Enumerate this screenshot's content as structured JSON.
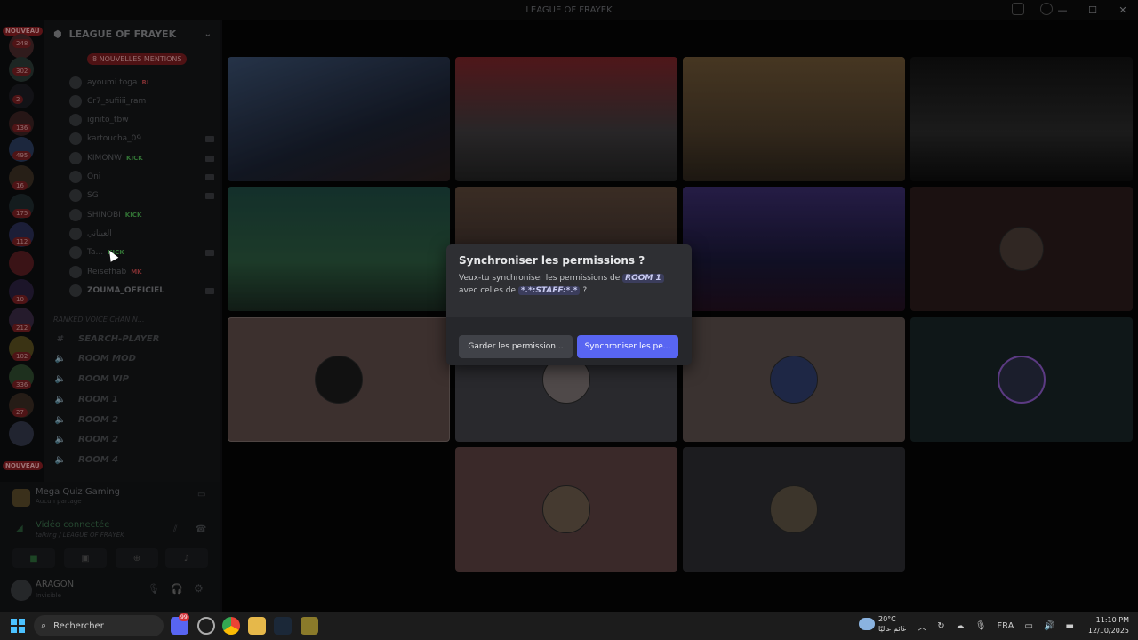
{
  "window": {
    "title": "LEAGUE OF FRAYEK"
  },
  "rail": {
    "nouveau_top": "NOUVEAU",
    "nouveau_bottom": "NOUVEAU",
    "badges": [
      "248",
      "302",
      "2",
      "136",
      "495",
      "16",
      "175",
      "112",
      "10",
      "212",
      "102",
      "336",
      "27"
    ]
  },
  "server": {
    "name": "LEAGUE OF FRAYEK",
    "mentions": "8 NOUVELLES MENTIONS",
    "members": [
      {
        "name": "ayoumi toga",
        "tag": "RL",
        "tag_color": "#c0474b"
      },
      {
        "name": "Cr7_sufiiii_ram",
        "tag": "",
        "tag_color": ""
      },
      {
        "name": "ignito_tbw",
        "tag": "",
        "tag_color": ""
      },
      {
        "name": "kartoucha_09",
        "tag": "",
        "tag_color": ""
      },
      {
        "name": "KIMONW",
        "tag": "KICK",
        "tag_color": "#4caf50"
      },
      {
        "name": "Oni",
        "tag": "",
        "tag_color": ""
      },
      {
        "name": "SG",
        "tag": "",
        "tag_color": ""
      },
      {
        "name": "SHINOBI",
        "tag": "KICK",
        "tag_color": "#4caf50"
      },
      {
        "name": "العيناني",
        "tag": "",
        "tag_color": ""
      },
      {
        "name": "Ta...",
        "tag": "KICK",
        "tag_color": "#4caf50"
      },
      {
        "name": "Reisefhab",
        "tag": "MK",
        "tag_color": "#c0474b"
      },
      {
        "name": "ZOUMA_OFFICIEL",
        "tag": "",
        "tag_color": ""
      }
    ],
    "category": "RANKED VOICE CHAN N...",
    "channels": [
      {
        "icon": "#",
        "name": "SEARCH-PLAYER"
      },
      {
        "icon": "🔈",
        "name": "ROOM MOD"
      },
      {
        "icon": "🔈",
        "name": "ROOM VIP"
      },
      {
        "icon": "🔈",
        "name": "ROOM 1"
      },
      {
        "icon": "🔈",
        "name": "ROOM 2"
      },
      {
        "icon": "🔈",
        "name": "ROOM 2"
      },
      {
        "icon": "🔈",
        "name": "ROOM 4"
      }
    ]
  },
  "voice": {
    "activity": "Mega Quiz Gaming",
    "activity_sub": "Aucun partage",
    "status": "Vidéo connectée",
    "location": "talking / LEAGUE OF FRAYEK",
    "user": "ARAGON",
    "user_status": "Invisible"
  },
  "dialog": {
    "title": "Synchroniser les permissions ?",
    "body_prefix": "Veux-tu synchroniser les permissions de",
    "channel_chip": "ROOM 1",
    "body_middle": "avec celles de",
    "role_chip": "*.*:STAFF:*.*",
    "body_suffix": "?",
    "keep_button": "Garder les permission...",
    "sync_button": "Synchroniser les pe..."
  },
  "taskbar": {
    "search_placeholder": "Rechercher",
    "discord_badge": "99",
    "temperature": "20°C",
    "weather_desc": "غائم عاليًا",
    "language": "FRA",
    "time": "11:10 PM",
    "date": "12/10/2025"
  }
}
